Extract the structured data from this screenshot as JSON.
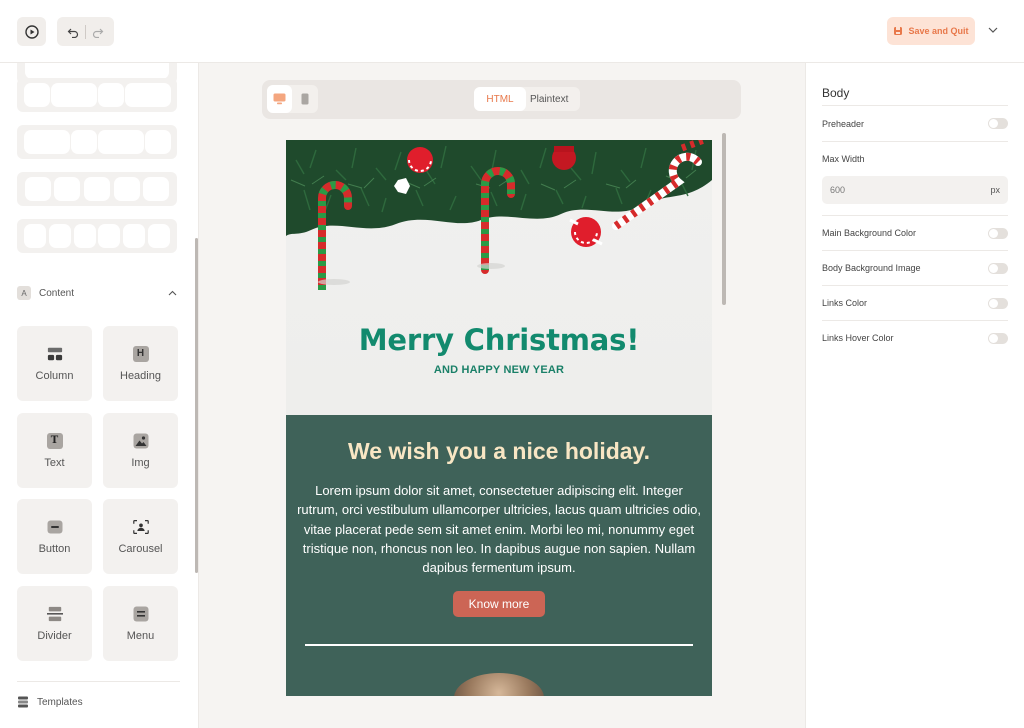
{
  "topbar": {
    "preview_icon": "play-circle-icon",
    "undo_icon": "undo-icon",
    "redo_icon": "redo-icon",
    "save_label": "Save and Quit",
    "save_icon": "save-icon",
    "menu_icon": "chevron-down-icon"
  },
  "left_panel": {
    "content_section": {
      "badge": "A",
      "label": "Content",
      "collapse_icon": "chevron-up-icon"
    },
    "blocks": [
      {
        "label": "Column",
        "icon": "column-icon"
      },
      {
        "label": "Heading",
        "icon": "heading-icon",
        "glyph": "H"
      },
      {
        "label": "Text",
        "icon": "text-icon",
        "glyph": "T"
      },
      {
        "label": "Img",
        "icon": "image-icon"
      },
      {
        "label": "Button",
        "icon": "button-icon"
      },
      {
        "label": "Carousel",
        "icon": "carousel-icon"
      },
      {
        "label": "Divider",
        "icon": "divider-icon"
      },
      {
        "label": "Menu",
        "icon": "menu-icon"
      }
    ],
    "templates_label": "Templates"
  },
  "canvas_toolbar": {
    "devices": [
      "desktop-icon",
      "mobile-icon"
    ],
    "active_device": "desktop",
    "modes": [
      "HTML",
      "Plaintext"
    ],
    "active_mode": "HTML"
  },
  "email": {
    "hero_title": "Merry Christmas!",
    "hero_subtitle": "AND HAPPY NEW YEAR",
    "wish_heading": "We wish you a nice holiday.",
    "body_text": "Lorem ipsum dolor sit amet, consectetuer adipiscing elit. Integer rutrum, orci vestibulum ullamcorper ultricies, lacus quam ultricies odio, vitae placerat pede sem sit amet enim. Morbi leo mi, nonummy eget tristique non, rhoncus non leo. In dapibus augue non sapien. Nullam dapibus fermentum ipsum.",
    "cta_label": "Know more"
  },
  "right_panel": {
    "title": "Body",
    "preheader_label": "Preheader",
    "max_width_label": "Max Width",
    "max_width_value": "600",
    "max_width_unit": "px",
    "main_bg_label": "Main Background Color",
    "body_bg_image_label": "Body Background Image",
    "links_color_label": "Links Color",
    "links_hover_label": "Links Hover Color"
  },
  "colors": {
    "accent": "#e8784a",
    "accent_bg": "#fde3d6",
    "email_green": "#3f6259",
    "hero_title": "#128a6e",
    "wish_heading": "#f8e6c4",
    "cta": "#cc6555"
  }
}
